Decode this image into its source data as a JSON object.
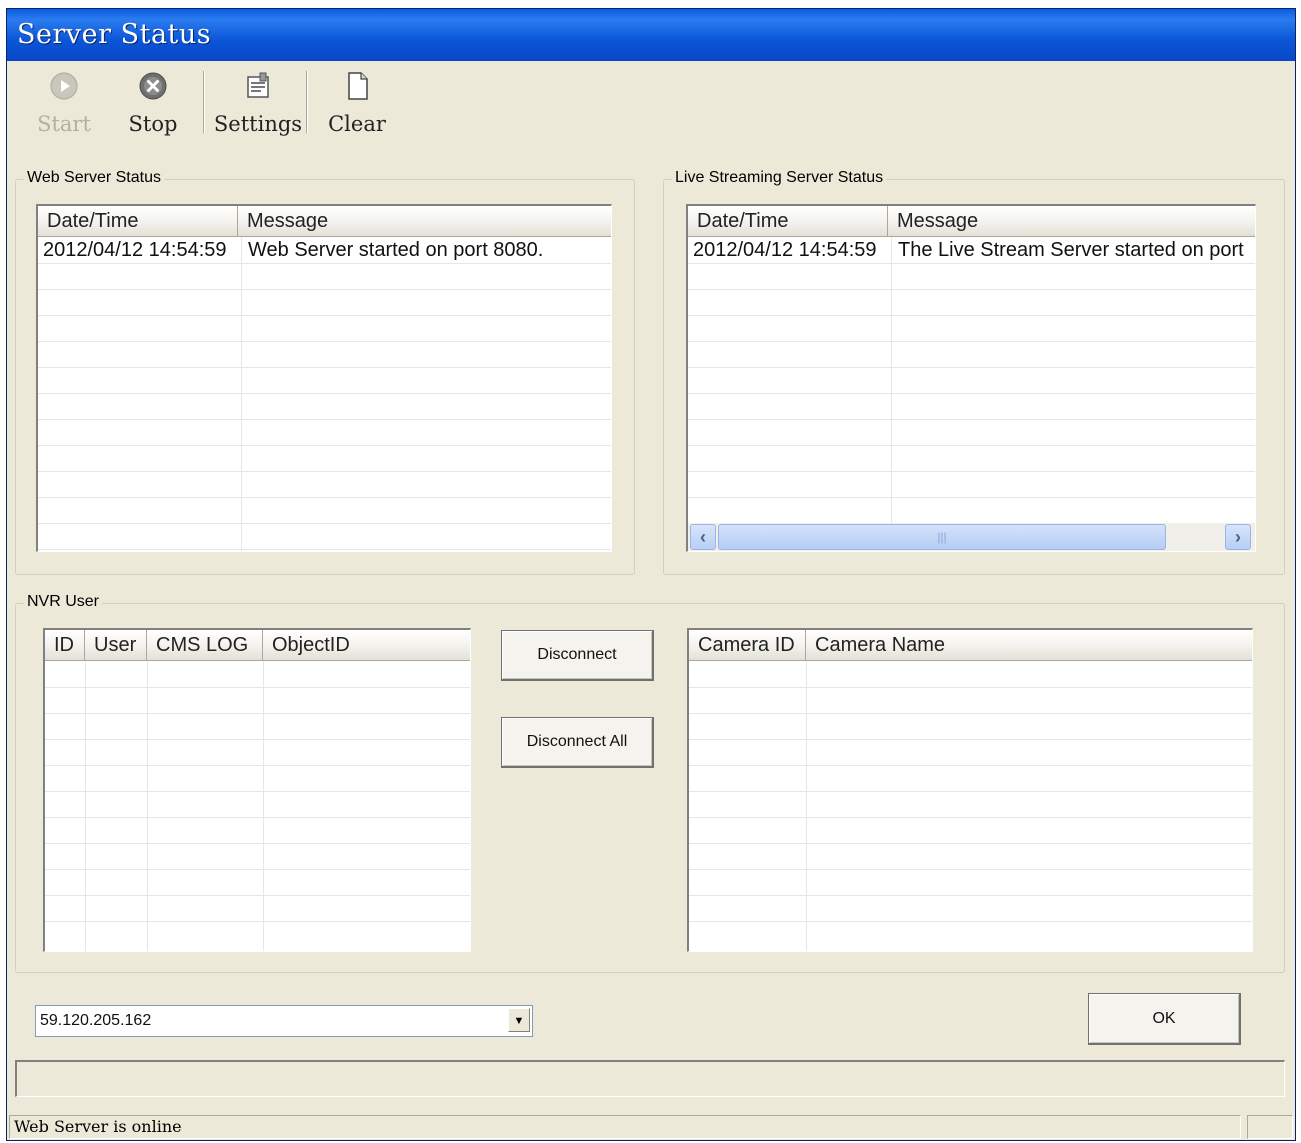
{
  "window": {
    "title": "Server Status"
  },
  "toolbar": {
    "start_label": "Start",
    "stop_label": "Stop",
    "settings_label": "Settings",
    "clear_label": "Clear"
  },
  "web_server": {
    "group_title": "Web Server Status",
    "columns": [
      "Date/Time",
      "Message"
    ],
    "rows": [
      {
        "datetime": "2012/04/12 14:54:59",
        "message": "Web Server started on port 8080."
      }
    ]
  },
  "live_streaming": {
    "group_title": "Live Streaming Server Status",
    "columns": [
      "Date/Time",
      "Message"
    ],
    "rows": [
      {
        "datetime": "2012/04/12 14:54:59",
        "message": "The Live Stream Server started on port"
      }
    ]
  },
  "nvr_user": {
    "group_title": "NVR User",
    "user_columns": [
      "ID",
      "User",
      "CMS LOG",
      "ObjectID"
    ],
    "camera_columns": [
      "Camera ID",
      "Camera Name"
    ],
    "disconnect_label": "Disconnect",
    "disconnect_all_label": "Disconnect All"
  },
  "bottom": {
    "ip_value": "59.120.205.162",
    "ok_label": "OK"
  },
  "statusbar": {
    "text": "Web Server is online"
  }
}
